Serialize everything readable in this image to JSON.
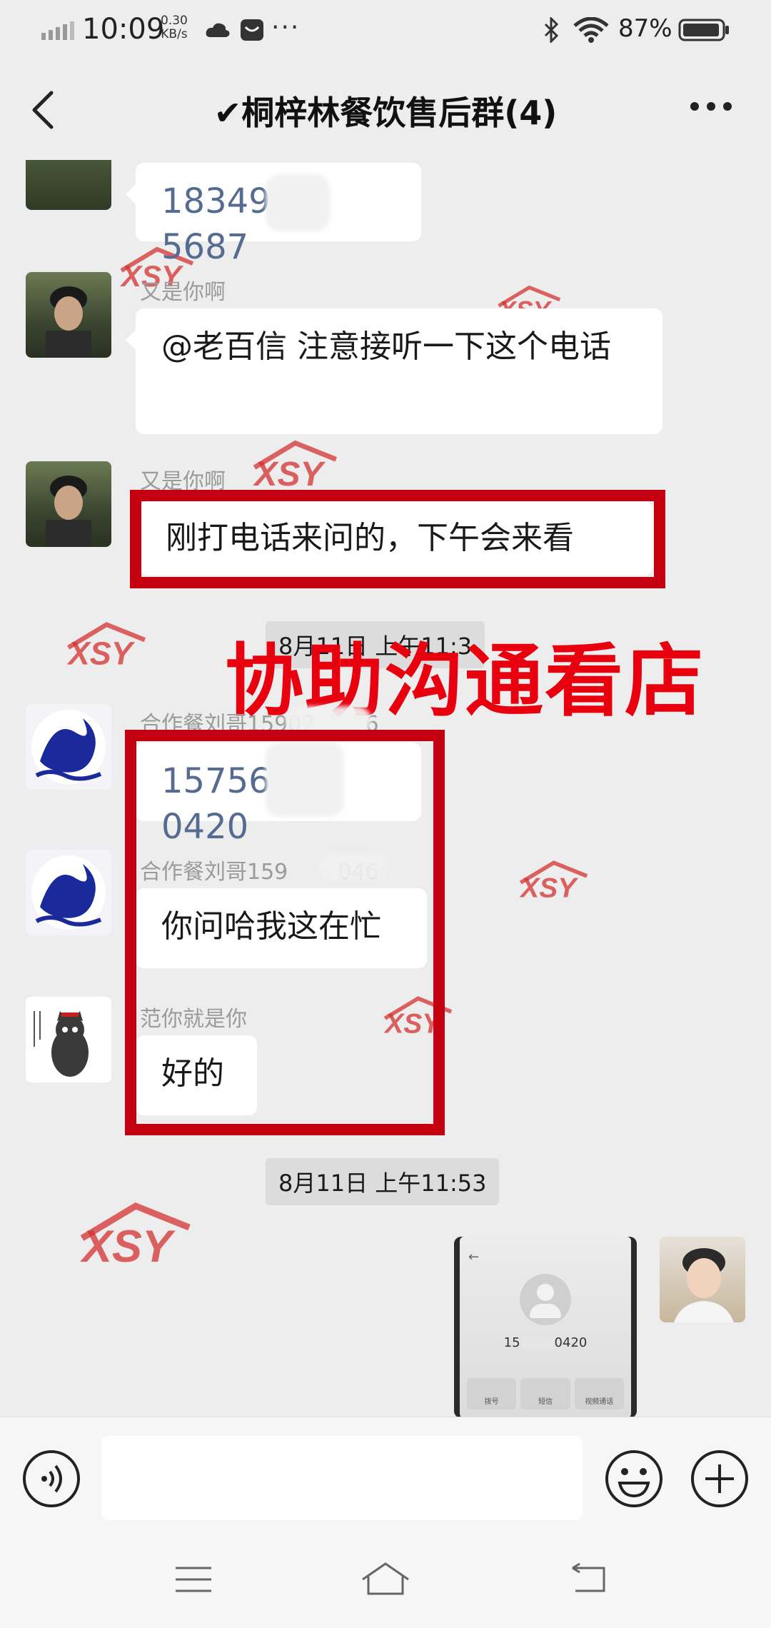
{
  "status_bar": {
    "time": "10:09",
    "speed_value": "0.30",
    "speed_unit": "KB/s",
    "more": "···",
    "battery_percent": "87%"
  },
  "nav": {
    "title": "✔桐梓林餐饮售后群(4)",
    "back_icon": "chevron-left-icon",
    "menu_icon": "more-dots-icon"
  },
  "messages": [
    {
      "sender": "",
      "text": "18349",
      "text_tail": "5687",
      "type": "phone"
    },
    {
      "sender": "又是你啊",
      "text": "@老百信  注意接听一下这个电话",
      "type": "text"
    },
    {
      "sender": "又是你啊",
      "text": "刚打电话来问的，下午会来看",
      "type": "text"
    },
    {
      "timestamp": "8月11日 上午11:3"
    },
    {
      "sender": "合作餐刘哥15902",
      "sender_tail": "6",
      "text": "15756",
      "text_tail": "0420",
      "type": "phone"
    },
    {
      "sender": "合作餐刘哥159",
      "sender_tail": "046",
      "text": "你问哈我这在忙",
      "type": "text"
    },
    {
      "sender": "范你就是你",
      "text": "好的",
      "type": "text"
    },
    {
      "timestamp": "8月11日 上午11:53"
    }
  ],
  "annotation": "协助沟通看店",
  "watermark_text": "XSY",
  "screenshot_thumb": {
    "number_head": "15",
    "number_tail": "0420",
    "buttons": [
      "拨号",
      "短信",
      "视频通话"
    ]
  },
  "colors": {
    "red": "#c40010",
    "phone_blue": "#566b91",
    "background": "#ededed"
  }
}
